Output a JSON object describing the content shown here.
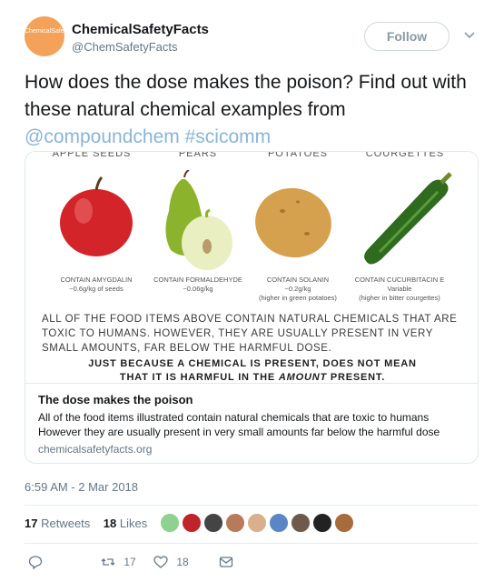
{
  "author": {
    "avatar_text": "ChemicalSafetyFacts",
    "name": "ChemicalSafetyFacts",
    "handle": "@ChemSafetyFacts",
    "follow_label": "Follow"
  },
  "tweet": {
    "text_plain": "How does the dose makes the poison? Find out with these natural chemical examples from",
    "mention": "@compoundchem",
    "hashtag": "#scicomm",
    "timestamp": "6:59 AM - 2 Mar 2018"
  },
  "infographic": {
    "categories": [
      "APPLE SEEDS",
      "PEARS",
      "POTATOES",
      "COURGETTES"
    ],
    "captions": [
      {
        "line1": "CONTAIN AMYGDALIN",
        "line2": "~0.6g/kg of seeds",
        "line3": ""
      },
      {
        "line1": "CONTAIN FORMALDEHYDE",
        "line2": "~0.06g/kg",
        "line3": ""
      },
      {
        "line1": "CONTAIN SOLANIN",
        "line2": "~0.2g/kg",
        "line3": "(higher in green potatoes)"
      },
      {
        "line1": "CONTAIN CUCURBITACIN E",
        "line2": "Variable",
        "line3": "(higher in bitter courgettes)"
      }
    ],
    "paragraph": "ALL OF THE FOOD ITEMS ABOVE CONTAIN NATURAL CHEMICALS THAT ARE TOXIC TO HUMANS. HOWEVER, THEY ARE USUALLY PRESENT IN VERY SMALL AMOUNTS, FAR BELOW THE HARMFUL DOSE.",
    "emphasis_before": "JUST BECAUSE A CHEMICAL IS PRESENT, DOES NOT MEAN THAT IT IS HARMFUL IN THE",
    "emphasis_word": "AMOUNT",
    "emphasis_after": "PRESENT."
  },
  "card": {
    "title": "The dose makes the poison",
    "description": "All of the food items illustrated contain natural chemicals that are toxic to humans However they are usually present in very small amounts far below the harmful dose",
    "domain": "chemicalsafetyfacts.org"
  },
  "stats": {
    "retweets_count": "17",
    "retweets_label": "Retweets",
    "likes_count": "18",
    "likes_label": "Likes"
  },
  "actions": {
    "reply_count": "",
    "retweet_count": "17",
    "like_count": "18"
  },
  "colors": {
    "link": "#8ab4d6",
    "muted": "#657786",
    "avatar": "#f4a259"
  }
}
